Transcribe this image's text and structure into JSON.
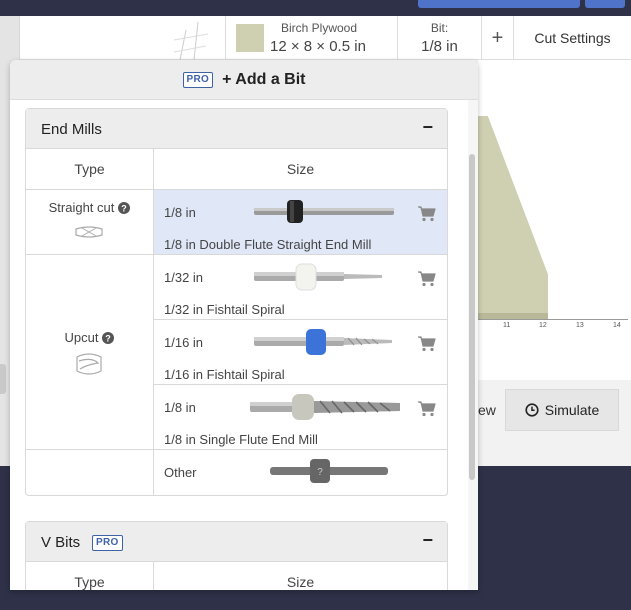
{
  "material": {
    "name": "Birch Plywood",
    "dimensions": "12 × 8 × 0.5 in",
    "swatch_color": "#cfcfb2"
  },
  "bit_selector": {
    "label": "Bit:",
    "value": "1/8 in"
  },
  "toolbar": {
    "plus_label": "+",
    "cut_settings_label": "Cut Settings",
    "preview_label": "ew",
    "simulate_label": "Simulate"
  },
  "ruler": {
    "ticks": [
      "11",
      "12",
      "13",
      "14"
    ]
  },
  "modal": {
    "pro_badge": "PRO",
    "title": "+ Add a Bit",
    "end_mills": {
      "title": "End Mills",
      "toggle": "−",
      "col_type": "Type",
      "col_size": "Size",
      "types": [
        {
          "label": "Straight cut"
        },
        {
          "label": "Upcut"
        }
      ],
      "bits": [
        {
          "size": "1/8 in",
          "name": "1/8 in Double Flute Straight End Mill",
          "selected": true
        },
        {
          "size": "1/32 in",
          "name": "1/32 in Fishtail Spiral",
          "selected": false
        },
        {
          "size": "1/16 in",
          "name": "1/16 in Fishtail Spiral",
          "selected": false
        },
        {
          "size": "1/8 in",
          "name": "1/8 in Single Flute End Mill",
          "selected": false
        },
        {
          "size": "Other",
          "name": "",
          "selected": false
        }
      ]
    },
    "v_bits": {
      "title": "V Bits",
      "pro_badge": "PRO",
      "toggle": "−",
      "col_type": "Type",
      "col_size": "Size"
    }
  },
  "colors": {
    "accent": "#3e62a8",
    "selected_row": "#e0e8f8",
    "dark_bg": "#2e3148",
    "collar_blue": "#3b73d8"
  }
}
